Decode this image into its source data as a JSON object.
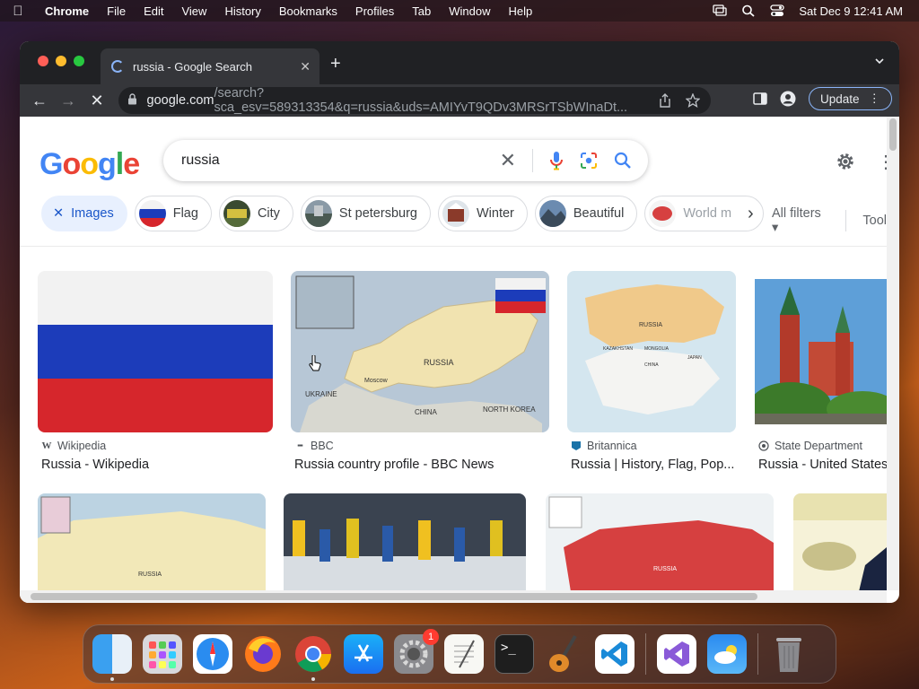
{
  "menubar": {
    "app": "Chrome",
    "items": [
      "File",
      "Edit",
      "View",
      "History",
      "Bookmarks",
      "Profiles",
      "Tab",
      "Window",
      "Help"
    ],
    "datetime": "Sat Dec 9  12:41 AM"
  },
  "browser": {
    "tab_title": "russia - Google Search",
    "url_host": "google.com",
    "url_rest": "/search?sca_esv=589313354&q=russia&uds=AMIYvT9QDv3MRSrTSbWInaDt...",
    "update_label": "Update"
  },
  "search": {
    "query": "russia"
  },
  "chips": [
    {
      "label": "Images",
      "active": true
    },
    {
      "label": "Flag"
    },
    {
      "label": "City"
    },
    {
      "label": "St petersburg"
    },
    {
      "label": "Winter"
    },
    {
      "label": "Beautiful"
    },
    {
      "label": "World m"
    }
  ],
  "filters": {
    "all_filters": "All filters",
    "tools": "Tool"
  },
  "results": [
    {
      "source": "Wikipedia",
      "title": "Russia - Wikipedia"
    },
    {
      "source": "BBC",
      "title": "Russia country profile - BBC News"
    },
    {
      "source": "Britannica",
      "title": "Russia | History, Flag, Pop..."
    },
    {
      "source": "State Department",
      "title": "Russia - United States"
    }
  ],
  "map_labels": {
    "bbc_russia": "RUSSIA",
    "bbc_moscow": "Moscow",
    "bbc_ukraine": "UKRAINE",
    "bbc_china": "CHINA",
    "bbc_nk": "NORTH KOREA",
    "brit_russia": "RUSSIA",
    "brit_kaz": "KAZAKHSTAN",
    "brit_mongolia": "MONGOLIA",
    "brit_china": "CHINA",
    "brit_japan": "JAPAN",
    "row2_russia": "RUSSIA",
    "row2_russia2": "RUSSIA"
  },
  "dock": {
    "apps": [
      "finder",
      "launchpad",
      "safari",
      "firefox",
      "chrome",
      "app-store",
      "system-settings",
      "textedit",
      "terminal",
      "garageband",
      "vscode",
      "visual-studio",
      "weather",
      "trash"
    ],
    "settings_badge": "1"
  },
  "colors": {
    "accent_blue": "#1a73e8",
    "chip_active_bg": "#e8f0fe",
    "flag_white": "#f2f2f2",
    "flag_blue": "#1c3cba",
    "flag_red": "#d6262c"
  }
}
